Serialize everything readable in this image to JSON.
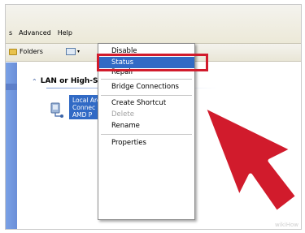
{
  "menubar": {
    "items": [
      "s",
      "Advanced",
      "Help"
    ]
  },
  "toolbar": {
    "folders_label": "Folders",
    "views_caret": "▾"
  },
  "section": {
    "title": "LAN or High-Speed Internet",
    "chevron": "⌃"
  },
  "connection": {
    "lines": [
      "Local Area Connection",
      "Connec",
      "AMD P"
    ]
  },
  "context_menu": {
    "items": [
      {
        "label": "Disable",
        "state": "partial"
      },
      {
        "label": "Status",
        "state": "selected"
      },
      {
        "label": "Repair",
        "state": "partial"
      },
      {
        "label": "Bridge Connections",
        "state": "normal"
      },
      {
        "label": "Create Shortcut",
        "state": "normal"
      },
      {
        "label": "Delete",
        "state": "disabled"
      },
      {
        "label": "Rename",
        "state": "normal"
      },
      {
        "label": "Properties",
        "state": "normal"
      }
    ]
  },
  "annotation": {
    "box_color": "#d11b2c",
    "arrow_color": "#d11b2c",
    "arrow_border": "#ffffff"
  },
  "watermark": "wikiHow",
  "colors": {
    "selection_blue": "#316ac5",
    "left_pane": "#7aa1e6"
  },
  "icons": {
    "folders": "folder-icon",
    "views": "views-icon",
    "connection": "network-connection-icon"
  }
}
